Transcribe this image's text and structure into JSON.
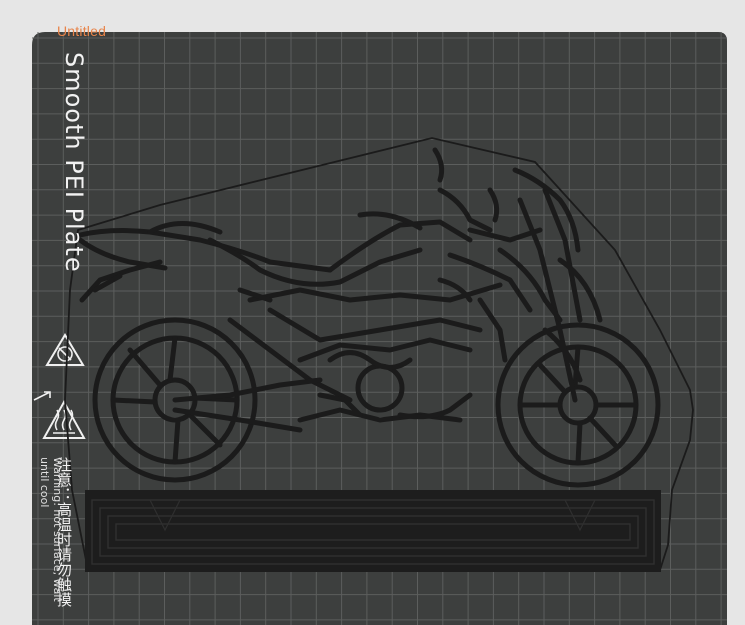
{
  "project": {
    "title": "Untitled"
  },
  "plate": {
    "label": "Smooth PEI Plate",
    "warning_cn": "注意：高温时请勿触摸",
    "warning_en": "Warning: hot surface, wait until cool"
  },
  "icons": [
    "no-touch-hand-icon",
    "hot-surface-icon"
  ],
  "colors": {
    "background": "#e6e6e6",
    "plate": "#3d3f3e",
    "grid": "#5c5e5d",
    "model": "#1b1b1b",
    "title_accent": "#e8844a"
  }
}
